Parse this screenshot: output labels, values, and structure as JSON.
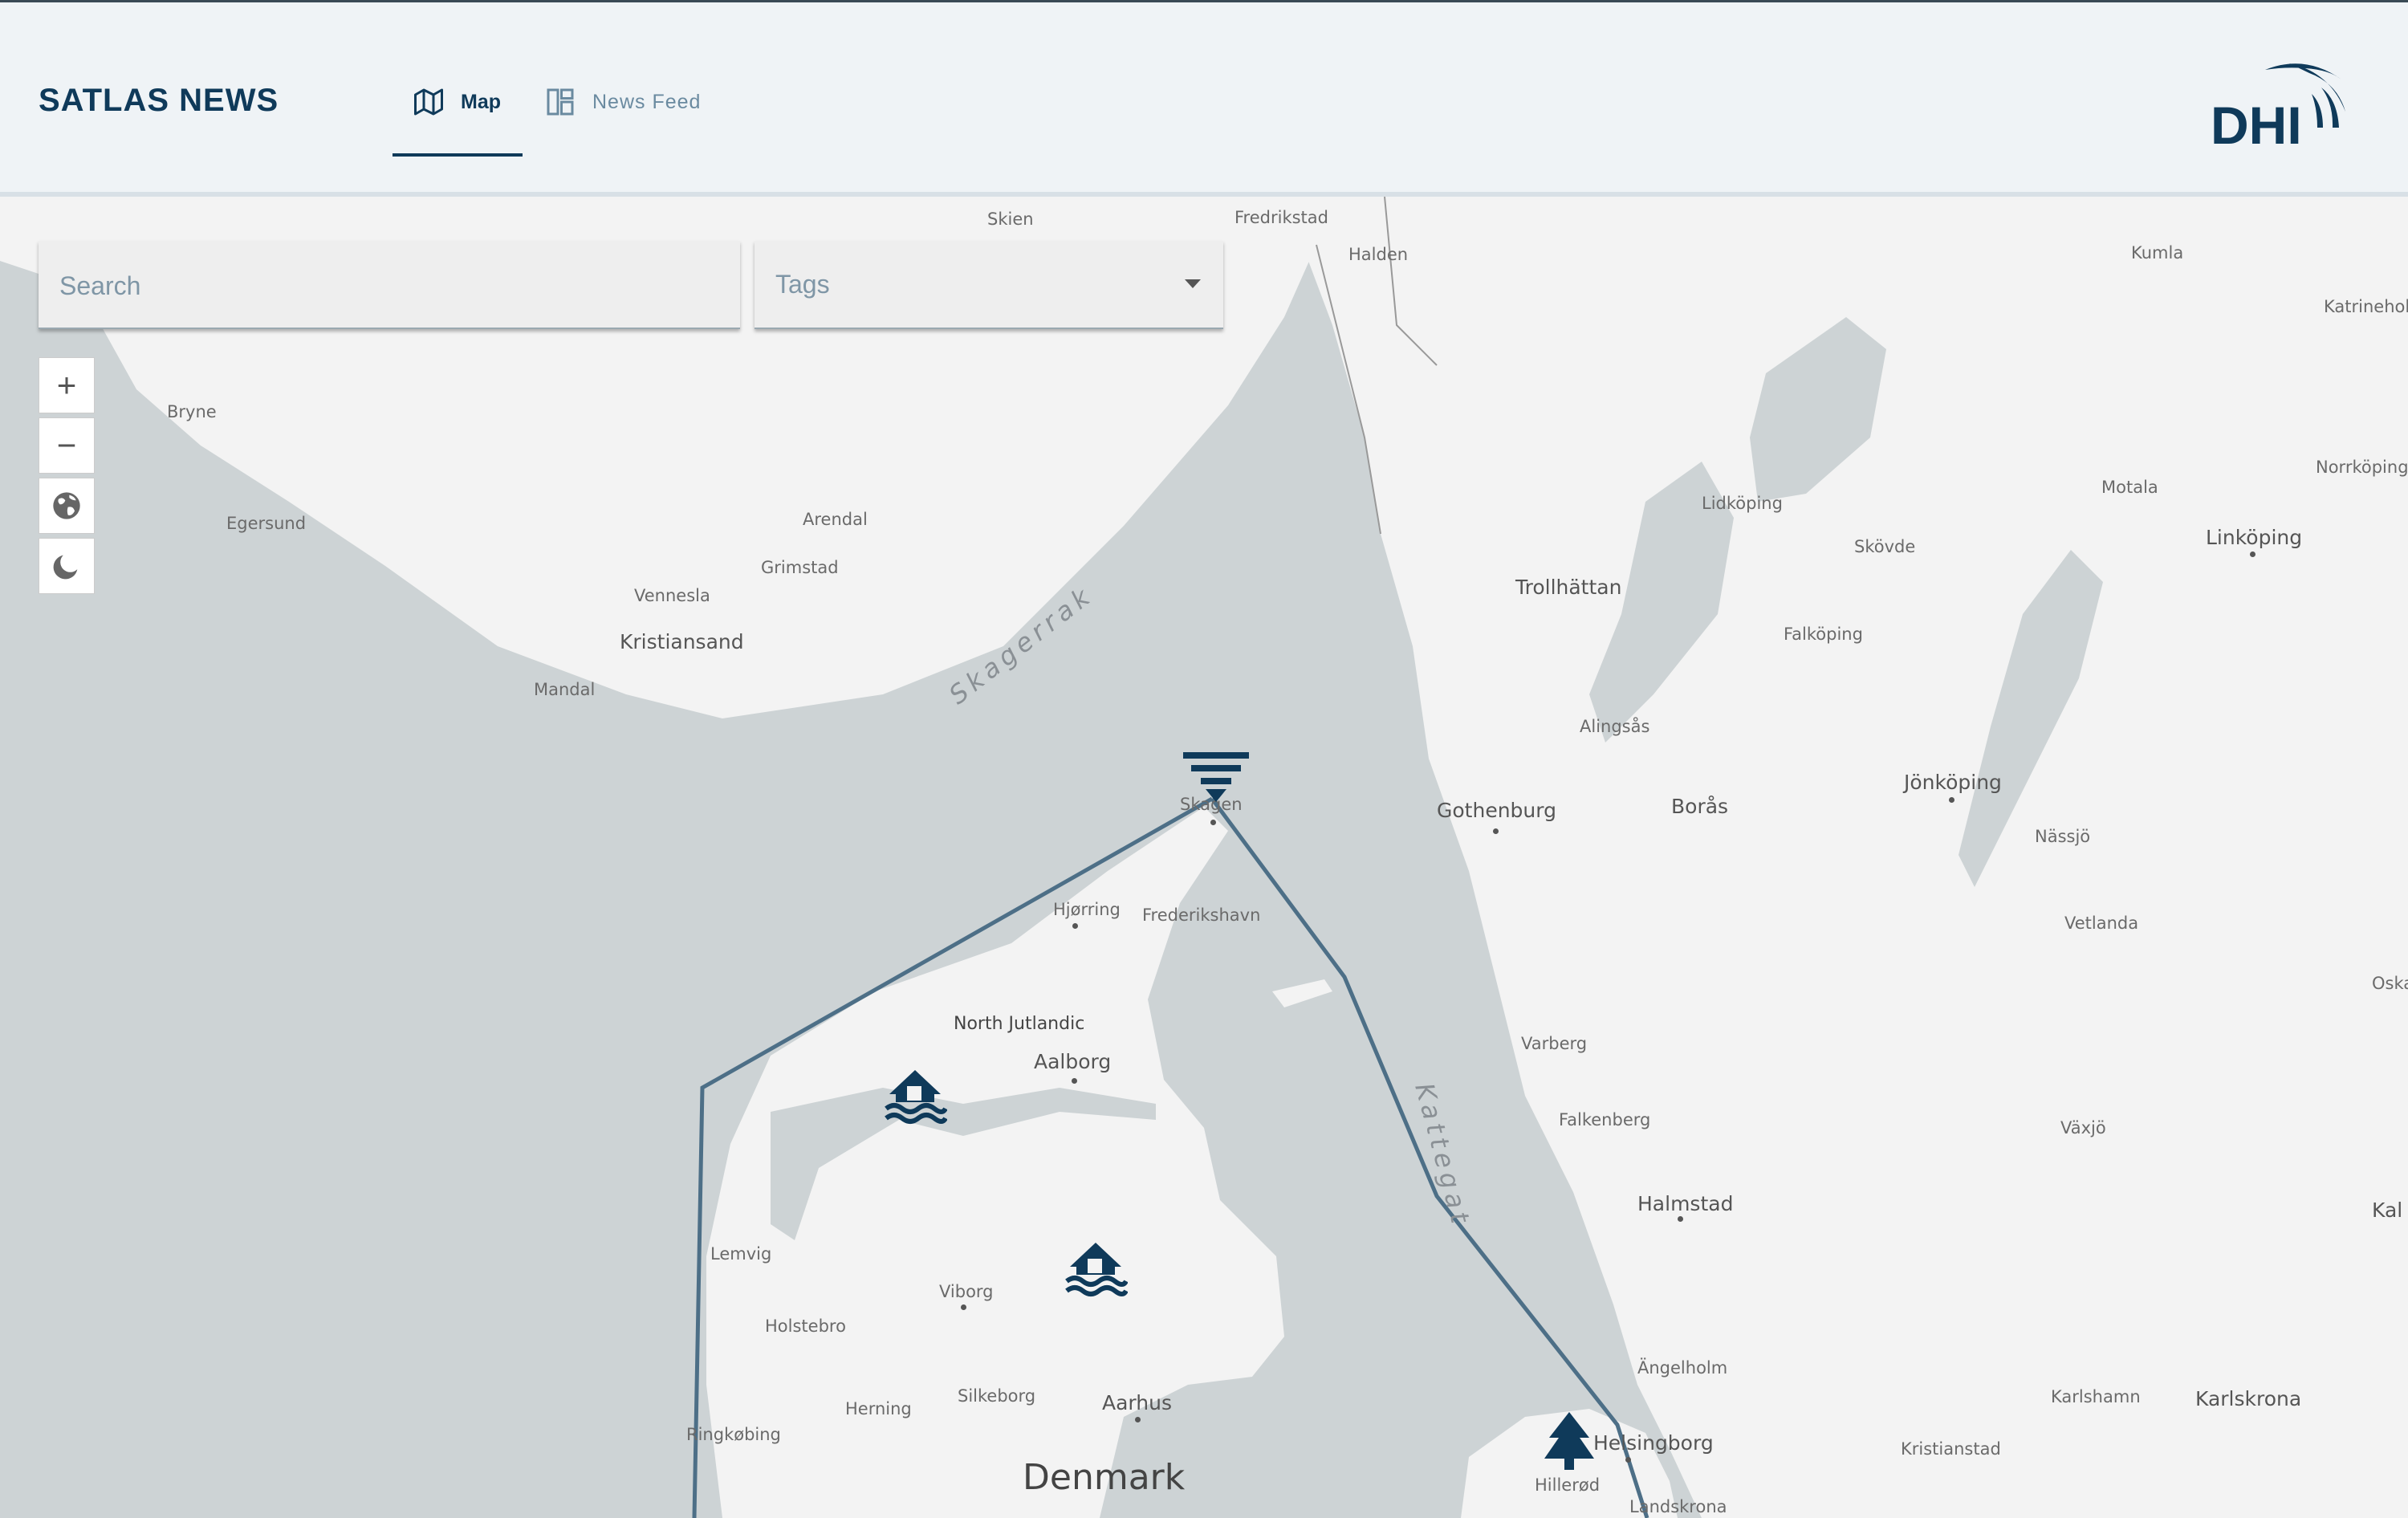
{
  "app": {
    "title": "SATLAS NEWS",
    "logo_text": "DHI"
  },
  "nav": {
    "tabs": [
      {
        "label": "Map",
        "icon": "map-icon",
        "active": true
      },
      {
        "label": "News Feed",
        "icon": "dashboard-icon",
        "active": false
      }
    ]
  },
  "filters": {
    "search_placeholder": "Search",
    "tags_label": "Tags"
  },
  "map_controls": {
    "zoom_in": "+",
    "zoom_out": "−"
  },
  "map": {
    "places": {
      "skien": "Skien",
      "fredrikstad": "Fredrikstad",
      "halden": "Halden",
      "kumla": "Kumla",
      "katrineholm": "Katrineholm",
      "bryne": "Bryne",
      "norrkoping": "Norrköping",
      "motala": "Motala",
      "linkoping": "Linköping",
      "lidkoping": "Lidköping",
      "skovde": "Skövde",
      "egersund": "Egersund",
      "arendal": "Arendal",
      "grimstad": "Grimstad",
      "trollhattan": "Trollhättan",
      "falkoping": "Falköping",
      "vennesla": "Vennesla",
      "kristiansand": "Kristiansand",
      "mandal": "Mandal",
      "alingsas": "Alingsås",
      "jonkoping": "Jönköping",
      "gothenburg": "Gothenburg",
      "boras": "Borås",
      "skagen": "Skagen",
      "nassjo": "Nässjö",
      "hjorring": "Hjørring",
      "frederikshavn": "Frederikshavn",
      "vetlanda": "Vetlanda",
      "oskarshamn": "Oska",
      "north_jutlandic": "North Jutlandic",
      "aalborg": "Aalborg",
      "varberg": "Varberg",
      "falkenberg": "Falkenberg",
      "vaxjo": "Växjö",
      "lemvig": "Lemvig",
      "halmstad": "Halmstad",
      "kalmar": "Kal",
      "viborg": "Viborg",
      "holstebro": "Holstebro",
      "angelholm": "Ängelholm",
      "silkeborg": "Silkeborg",
      "herning": "Herning",
      "aarhus": "Aarhus",
      "karlshamn": "Karlshamn",
      "karlskrona": "Karlskrona",
      "ringkobing": "Ringkøbing",
      "helsingborg": "Helsingborg",
      "kristianstad": "Kristianstad",
      "hillerod": "Hillerød",
      "landskrona": "Landskrona",
      "denmark": "Denmark",
      "skagerrak": "Skagerrak",
      "kattegat": "Kattegat"
    },
    "markers": [
      {
        "type": "flood",
        "icon": "flood-house-icon"
      },
      {
        "type": "flood",
        "icon": "flood-house-icon"
      },
      {
        "type": "tree",
        "icon": "tree-icon"
      },
      {
        "type": "water-level",
        "icon": "water-level-icon"
      }
    ],
    "colors": {
      "sea": "#cdd3d5",
      "land": "#f3f3f3",
      "route": "#4d6f87",
      "marker": "#0f3a5a"
    }
  }
}
